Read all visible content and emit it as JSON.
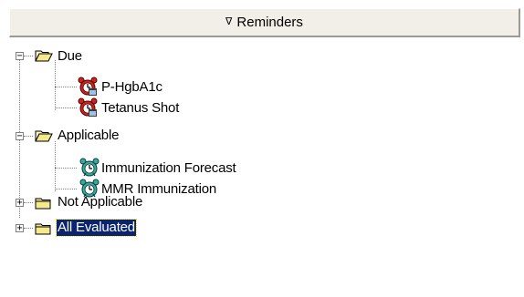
{
  "header": {
    "sort_glyph": "∇",
    "title": "Reminders"
  },
  "tree": {
    "groups": [
      {
        "label": "Due",
        "expander": "−",
        "children": [
          "P-HgbA1c",
          "Tetanus Shot"
        ]
      },
      {
        "label": "Applicable",
        "expander": "−",
        "children": [
          "Immunization Forecast",
          "MMR Immunization"
        ]
      },
      {
        "label": "Not Applicable",
        "expander": "+"
      },
      {
        "label": "All Evaluated",
        "expander": "+",
        "selected": true
      }
    ]
  },
  "icons": {
    "due_item": "red-alarm-clock-icon",
    "applicable_item": "teal-alarm-clock-icon",
    "folder_open": "open-folder-icon",
    "folder_closed": "closed-folder-icon"
  },
  "colors": {
    "selection_bg": "#0a2470",
    "folder_yellow": "#f6e98b",
    "due_red": "#c8261e",
    "applicable_teal": "#3aa9a0"
  }
}
